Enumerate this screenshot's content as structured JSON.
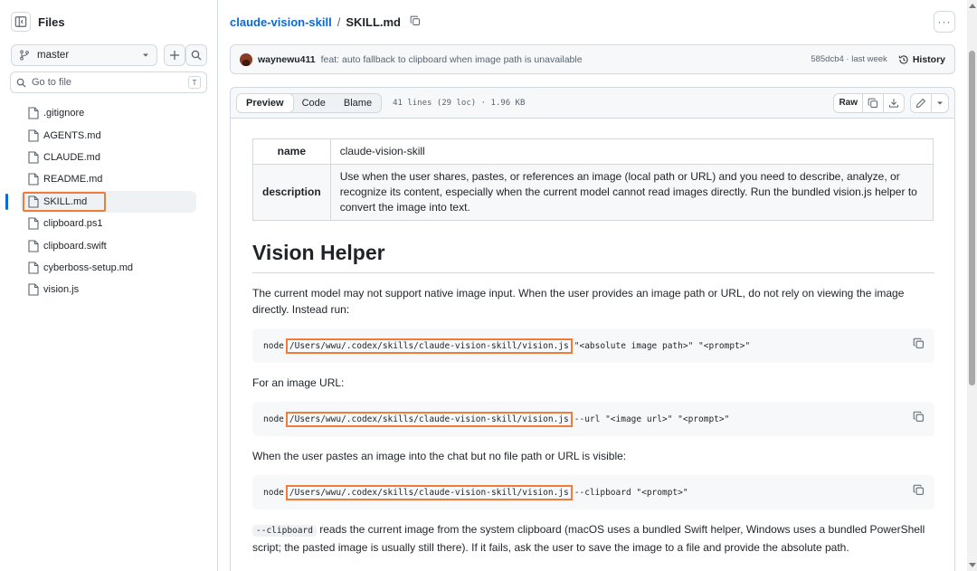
{
  "sidebar": {
    "title": "Files",
    "branch": "master",
    "search_placeholder": "Go to file",
    "search_shortcut": "T",
    "files": [
      {
        "name": ".gitignore"
      },
      {
        "name": "AGENTS.md"
      },
      {
        "name": "CLAUDE.md"
      },
      {
        "name": "README.md"
      },
      {
        "name": "SKILL.md",
        "selected": true
      },
      {
        "name": "clipboard.ps1"
      },
      {
        "name": "clipboard.swift"
      },
      {
        "name": "cyberboss-setup.md"
      },
      {
        "name": "vision.js"
      }
    ]
  },
  "breadcrumb": {
    "repo": "claude-vision-skill",
    "separator": "/",
    "file": "SKILL.md"
  },
  "commit": {
    "author": "waynewu411",
    "message": "feat: auto fallback to clipboard when image path is unavailable",
    "meta": "585dcb4 · last week",
    "history_label": "History"
  },
  "viewer": {
    "tabs": [
      "Preview",
      "Code",
      "Blame"
    ],
    "active_tab": "Preview",
    "file_info": "41 lines (29 loc) · 1.96 KB",
    "raw_label": "Raw"
  },
  "doc": {
    "table": {
      "name_label": "name",
      "name_value": "claude-vision-skill",
      "description_label": "description",
      "description_value": "Use when the user shares, pastes, or references an image (local path or URL) and you need to describe, analyze, or recognize its content, especially when the current model cannot read images directly. Run the bundled vision.js helper to convert the image into text."
    },
    "heading": "Vision Helper",
    "intro": "The current model may not support native image input. When the user provides an image path or URL, do not rely on viewing the image directly. Instead run:",
    "code1": {
      "pre": "node",
      "path": "/Users/wwu/.codex/skills/claude-vision-skill/vision.js",
      "post": "\"<absolute image path>\" \"<prompt>\""
    },
    "url_label": "For an image URL:",
    "code2": {
      "pre": "node",
      "path": "/Users/wwu/.codex/skills/claude-vision-skill/vision.js",
      "post": "--url \"<image url>\" \"<prompt>\""
    },
    "paste_label": "When the user pastes an image into the chat but no file path or URL is visible:",
    "code3": {
      "pre": "node",
      "path": "/Users/wwu/.codex/skills/claude-vision-skill/vision.js",
      "post": "--clipboard \"<prompt>\""
    },
    "clip_flag": "--clipboard",
    "clip_text": " reads the current image from the system clipboard (macOS uses a bundled Swift helper, Windows uses a bundled PowerShell script; the pasted image is usually still there). If it fails, ask the user to save the image to a file and provide the absolute path."
  },
  "colors": {
    "accent": "#0969da",
    "highlight": "#f07c3a",
    "border": "#d1d9e0"
  }
}
